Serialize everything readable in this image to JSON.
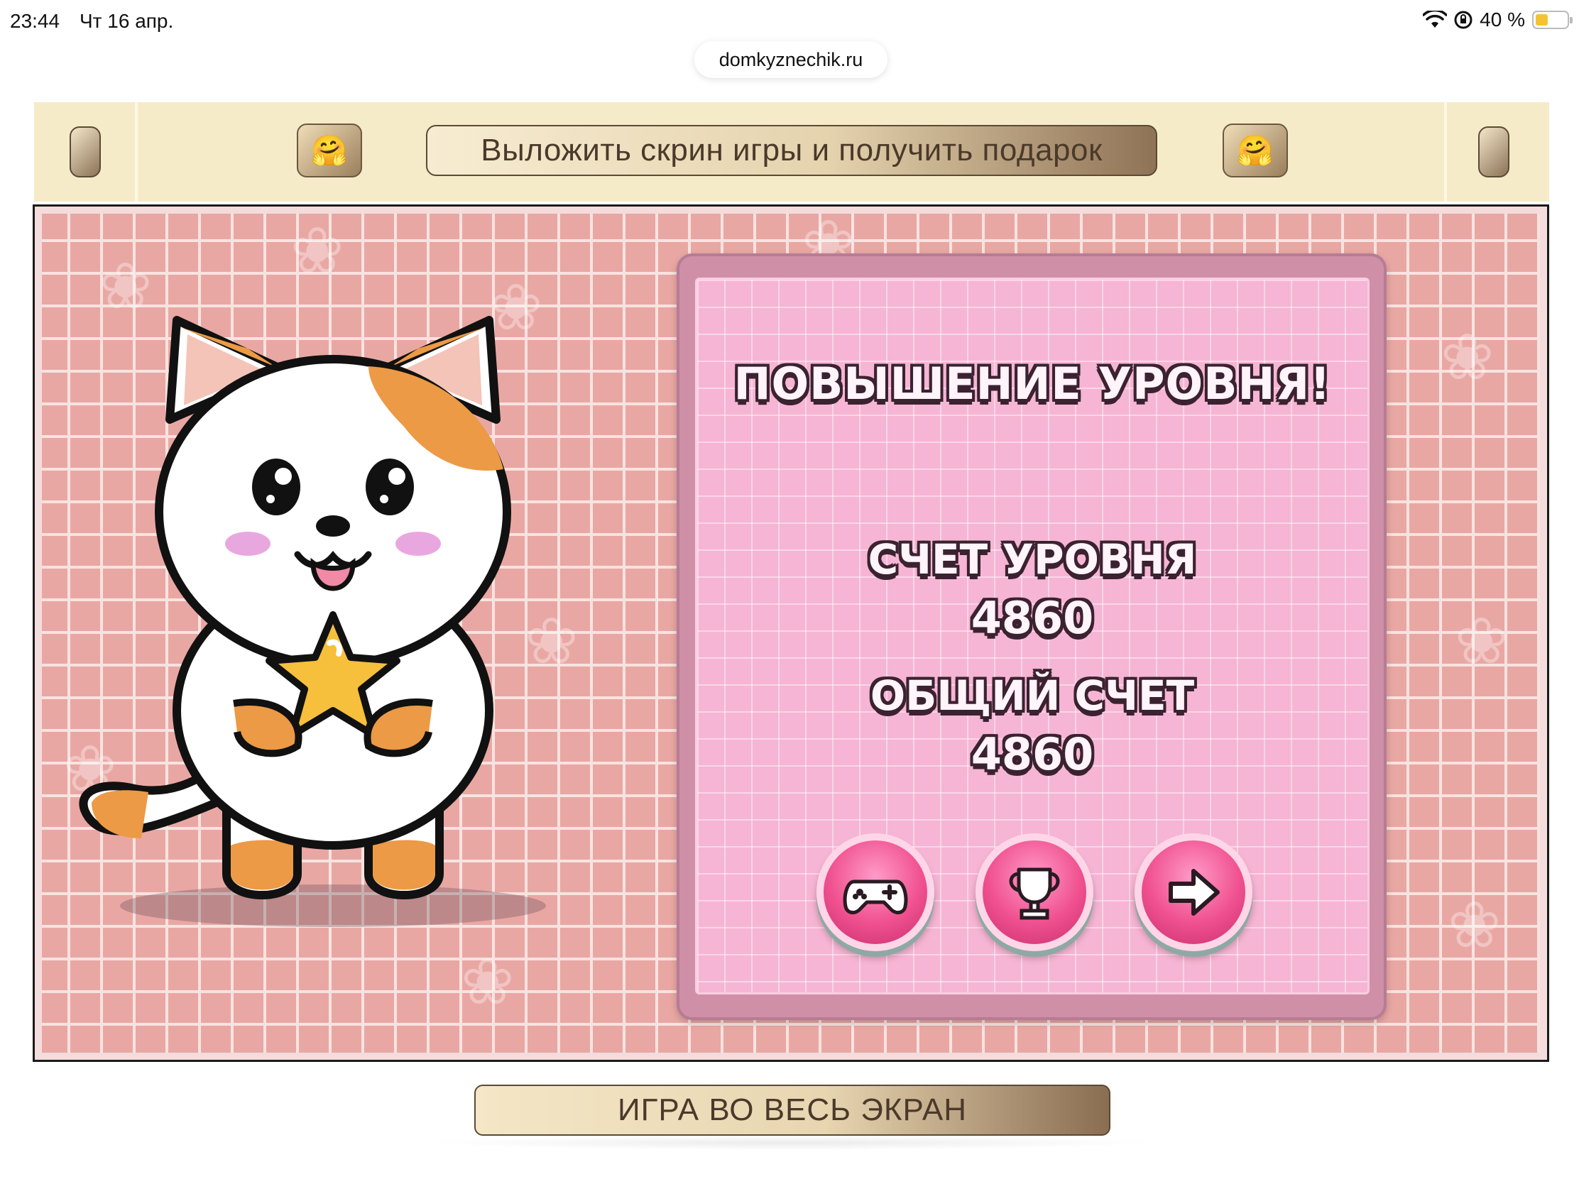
{
  "status_bar": {
    "time": "23:44",
    "date": "Чт 16 апр.",
    "battery_percent": "40 %",
    "battery_level": 0.4
  },
  "browser": {
    "url": "domkyznechik.ru"
  },
  "banner": {
    "promo_label": "Выложить скрин игры и получить подарок",
    "emoji": "🤗"
  },
  "game": {
    "panel": {
      "title": "ПОВЫШЕНИЕ УРОВНЯ!",
      "level_score_label": "СЧЕТ УРОВНЯ",
      "level_score_value": "4860",
      "total_score_label": "ОБЩИЙ СЧЕТ",
      "total_score_value": "4860"
    },
    "buttons": [
      {
        "icon": "gamepad-icon"
      },
      {
        "icon": "trophy-icon"
      },
      {
        "icon": "arrow-right-icon"
      }
    ]
  },
  "footer": {
    "fullscreen_label": "ИГРА ВО ВЕСЬ ЭКРАН"
  },
  "colors": {
    "banner_bg": "#f6ebc8",
    "tile_pink": "#e9a7a3",
    "panel_pink": "#f6b5d4",
    "button_pink": "#f0508f"
  }
}
